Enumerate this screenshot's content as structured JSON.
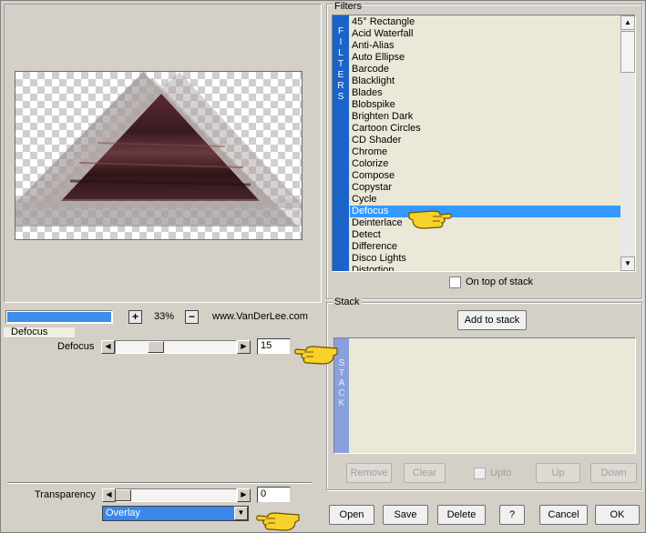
{
  "preview": {
    "zoom": "33%",
    "website": "www.VanDerLee.com",
    "zoom_in": "+",
    "zoom_out": "−",
    "progress": 1.0
  },
  "filters": {
    "group_title": "Filters",
    "band_letters": [
      "F",
      "I",
      "L",
      "T",
      "E",
      "R",
      "S"
    ],
    "items": [
      "45° Rectangle",
      "Acid Waterfall",
      "Anti-Alias",
      "Auto Ellipse",
      "Barcode",
      "Blacklight",
      "Blades",
      "Blobspike",
      "Brighten Dark",
      "Cartoon Circles",
      "CD Shader",
      "Chrome",
      "Colorize",
      "Compose",
      "Copystar",
      "Cycle",
      "Defocus",
      "Deinterlace",
      "Detect",
      "Difference",
      "Disco Lights",
      "Distortion"
    ],
    "selected": "Defocus",
    "on_top_label": "On top of stack"
  },
  "params": {
    "group_title": "Defocus",
    "defocus_label": "Defocus",
    "defocus_value": "15",
    "transparency_label": "Transparency",
    "transparency_value": "0",
    "blend_mode": "Overlay"
  },
  "stack": {
    "group_title": "Stack",
    "add_label": "Add to stack",
    "band_letters": [
      "S",
      "T",
      "A",
      "C",
      "K"
    ],
    "remove_label": "Remove",
    "clear_label": "Clear",
    "upto_label": "Upto",
    "up_label": "Up",
    "down_label": "Down"
  },
  "footer": {
    "open": "Open",
    "save": "Save",
    "delete": "Delete",
    "help": "?",
    "cancel": "Cancel",
    "ok": "OK"
  },
  "colors": {
    "selection": "#3399ff",
    "band": "#1a63c9",
    "stack_band": "#8aa0dc",
    "list_bg": "#ebe8d8",
    "pointer": "#f6d22a"
  },
  "icons": {
    "pointer": "pointing-hand-icon",
    "arrow_left": "◀",
    "arrow_right": "▶",
    "arrow_up": "▲",
    "arrow_down": "▼"
  }
}
